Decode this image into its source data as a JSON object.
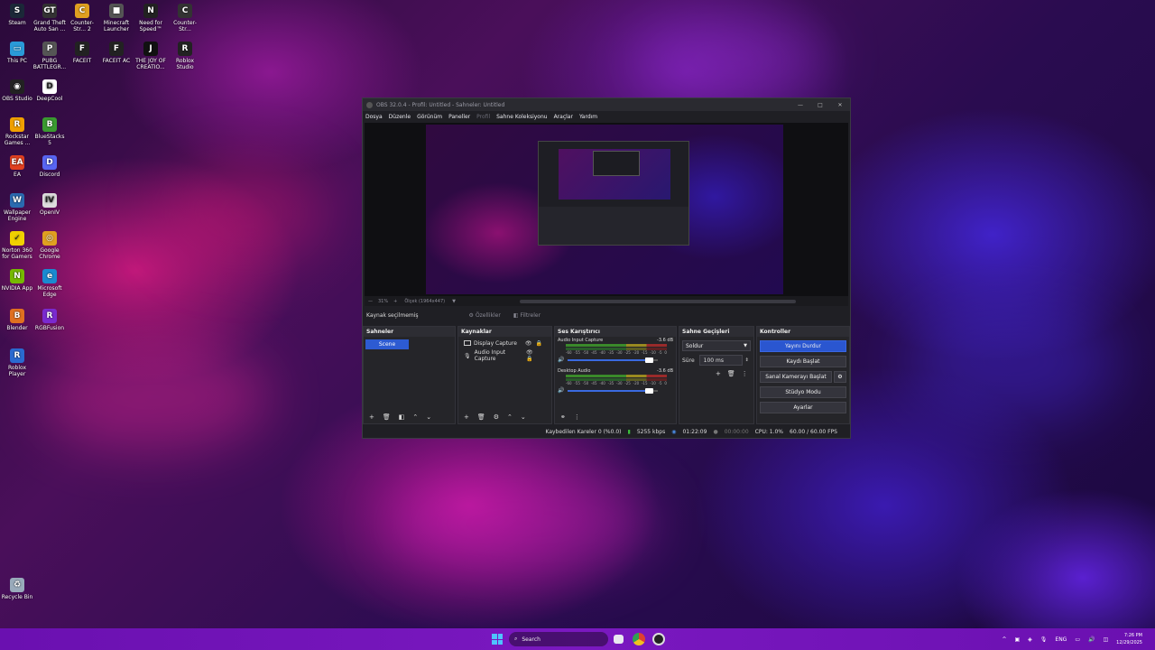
{
  "desktop": {
    "icons": [
      {
        "label": "Steam",
        "icon": "steam-icon",
        "color": "#1b2838",
        "glyph": "S"
      },
      {
        "label": "Grand Theft Auto San ...",
        "icon": "gta-icon",
        "color": "#333",
        "glyph": "GT"
      },
      {
        "label": "Counter-Str... 2",
        "icon": "cs2-icon",
        "color": "#e0a020",
        "glyph": "C"
      },
      {
        "label": "Minecraft Launcher",
        "icon": "minecraft-icon",
        "color": "#555",
        "glyph": "■"
      },
      {
        "label": "Need for Speed™ Heat",
        "icon": "nfs-icon",
        "color": "#222",
        "glyph": "N"
      },
      {
        "label": "Counter-Str...",
        "icon": "csgo-icon",
        "color": "#333",
        "glyph": "C"
      },
      {
        "label": "This PC",
        "icon": "this-pc-icon",
        "color": "#2a9ad8",
        "glyph": "▭"
      },
      {
        "label": "PUBG BATTLEGR...",
        "icon": "pubg-icon",
        "color": "#555",
        "glyph": "P"
      },
      {
        "label": "FACEIT",
        "icon": "faceit-icon",
        "color": "#222",
        "glyph": "F"
      },
      {
        "label": "FACEIT AC",
        "icon": "faceit-ac-icon",
        "color": "#222",
        "glyph": "F"
      },
      {
        "label": "THE JOY OF CREATIO...",
        "icon": "joy-of-creation-icon",
        "color": "#111",
        "glyph": "J"
      },
      {
        "label": "Roblox Studio",
        "icon": "roblox-studio-icon",
        "color": "#222",
        "glyph": "R"
      },
      {
        "label": "OBS Studio",
        "icon": "obs-icon",
        "color": "#222",
        "glyph": "◉"
      },
      {
        "label": "DeepCool",
        "icon": "deepcool-icon",
        "color": "#fff",
        "glyph": "D"
      },
      {
        "label": "Rockstar Games ...",
        "icon": "rockstar-icon",
        "color": "#f0a000",
        "glyph": "R"
      },
      {
        "label": "BlueStacks 5",
        "icon": "bluestacks-icon",
        "color": "#3a9a30",
        "glyph": "B"
      },
      {
        "label": "EA",
        "icon": "ea-icon",
        "color": "#e04020",
        "glyph": "EA"
      },
      {
        "label": "Discord",
        "icon": "discord-icon",
        "color": "#5865f2",
        "glyph": "D"
      },
      {
        "label": "Wallpaper Engine",
        "icon": "wallpaper-engine-icon",
        "color": "#2a6ab0",
        "glyph": "W"
      },
      {
        "label": "OpenIV",
        "icon": "openiv-icon",
        "color": "#ddd",
        "glyph": "IV"
      },
      {
        "label": "Norton 360 for Gamers",
        "icon": "norton-icon",
        "color": "#f0d000",
        "glyph": "✓"
      },
      {
        "label": "Google Chrome",
        "icon": "chrome-icon",
        "color": "#e0a020",
        "glyph": "◎"
      },
      {
        "label": "NVIDIA App",
        "icon": "nvidia-icon",
        "color": "#76b900",
        "glyph": "N"
      },
      {
        "label": "Microsoft Edge",
        "icon": "edge-icon",
        "color": "#1a8ad0",
        "glyph": "e"
      },
      {
        "label": "Blender",
        "icon": "blender-icon",
        "color": "#e07020",
        "glyph": "B"
      },
      {
        "label": "RGBFusion",
        "icon": "rgbfusion-icon",
        "color": "#7a2ad0",
        "glyph": "R"
      },
      {
        "label": "Roblox Player",
        "icon": "roblox-player-icon",
        "color": "#2a6ad0",
        "glyph": "R"
      },
      {
        "label": "Recycle Bin",
        "icon": "recycle-bin-icon",
        "color": "#9ab",
        "glyph": "♻"
      }
    ]
  },
  "obs": {
    "title": "OBS 32.0.4 - Profil: Untitled - Sahneler: Untitled",
    "menu": [
      "Dosya",
      "Düzenle",
      "Görünüm",
      "Paneller",
      "Profil",
      "Sahne Koleksiyonu",
      "Araçlar",
      "Yardım"
    ],
    "zoom": "31%",
    "scale_info": "Ölçek (1964x447)",
    "source_bar": {
      "selected": "Kaynak seçilmemiş",
      "properties": "Özellikler",
      "filters": "Filtreler"
    },
    "scenes": {
      "title": "Sahneler",
      "items": [
        "Scene"
      ]
    },
    "sources": {
      "title": "Kaynaklar",
      "items": [
        {
          "label": "Display Capture",
          "icon": "monitor-icon"
        },
        {
          "label": "Audio Input Capture",
          "icon": "microphone-icon"
        }
      ]
    },
    "mixer": {
      "title": "Ses Karıştırıcı",
      "scale": [
        "-60",
        "-55",
        "-50",
        "-45",
        "-40",
        "-35",
        "-30",
        "-25",
        "-20",
        "-15",
        "-10",
        "-5",
        "0"
      ],
      "channels": [
        {
          "name": "Audio Input Capture",
          "db": "-3.6 dB",
          "volume": 0.88
        },
        {
          "name": "Desktop Audio",
          "db": "-3.6 dB",
          "volume": 0.88
        }
      ]
    },
    "transitions": {
      "title": "Sahne Geçişleri",
      "selected": "Soldur",
      "duration_label": "Süre",
      "duration": "100 ms"
    },
    "controls": {
      "title": "Kontroller",
      "stream": "Yayını Durdur",
      "record": "Kaydı Başlat",
      "virtual_cam": "Sanal Kamerayı Başlat",
      "studio": "Stüdyo Modu",
      "settings": "Ayarlar"
    },
    "status": {
      "dropped": "Kaybedilen Kareler 0 (%0.0)",
      "bitrate": "5255 kbps",
      "stream_time": "01:22:09",
      "rec_time": "00:00:00",
      "cpu": "CPU: 1.0%",
      "fps": "60.00 / 60.00 FPS"
    }
  },
  "taskbar": {
    "search": "Search",
    "lang": "ENG",
    "time": "7:26 PM",
    "date": "12/29/2025"
  }
}
